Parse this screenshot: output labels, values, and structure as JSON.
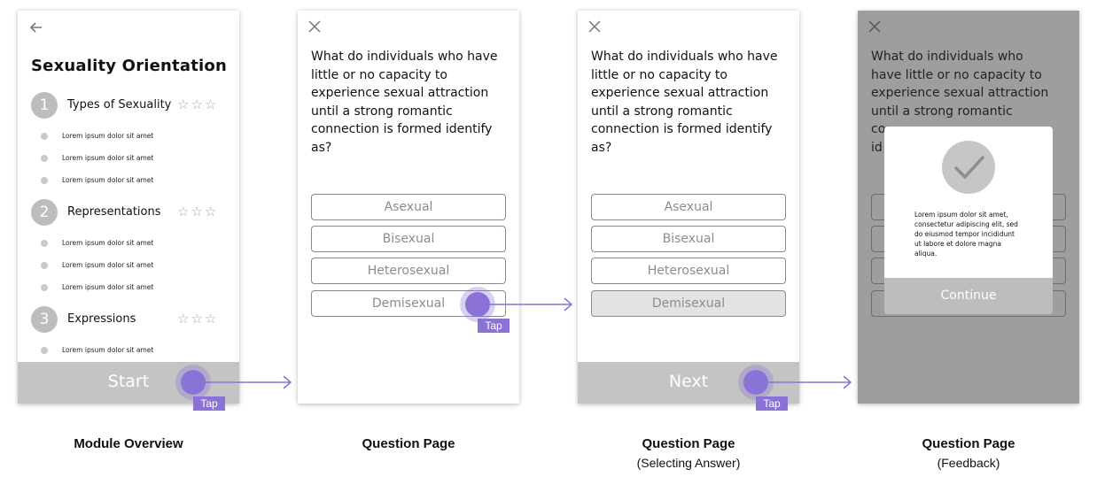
{
  "screens": {
    "module_overview": {
      "title": "Sexuality Orientation",
      "sections": [
        {
          "number": "1",
          "label": "Types of Sexuality",
          "stars": "☆☆☆",
          "items": [
            "Lorem ipsum dolor sit amet",
            "Lorem ipsum dolor sit amet",
            "Lorem ipsum dolor sit amet"
          ]
        },
        {
          "number": "2",
          "label": "Representations",
          "stars": "☆☆☆",
          "items": [
            "Lorem ipsum dolor sit amet",
            "Lorem ipsum dolor sit amet",
            "Lorem ipsum dolor sit amet"
          ]
        },
        {
          "number": "3",
          "label": "Expressions",
          "stars": "☆☆☆",
          "items": [
            "Lorem ipsum dolor sit amet"
          ]
        }
      ],
      "cta_label": "Start",
      "caption": {
        "title": "Module Overview"
      }
    },
    "question_page": {
      "question": "What do individuals who have little or no capacity to experience sexual attraction until a strong romantic connection is formed identify as?",
      "options": [
        "Asexual",
        "Bisexual",
        "Heterosexual",
        "Demisexual"
      ],
      "caption": {
        "title": "Question Page"
      }
    },
    "question_selecting": {
      "question": "What do individuals who have little or no capacity to experience sexual attraction until a strong romantic connection is formed identify as?",
      "options": [
        "Asexual",
        "Bisexual",
        "Heterosexual",
        "Demisexual"
      ],
      "selected_option": "Demisexual",
      "cta_label": "Next",
      "caption": {
        "title": "Question Page",
        "subtitle": "(Selecting Answer)"
      }
    },
    "question_feedback": {
      "question_visible_lines": [
        "What do individuals who",
        "have little or no capacity to",
        "experience sexual attraction",
        "until a strong romantic",
        "co",
        "id"
      ],
      "modal_text": "Lorem ipsum dolor sit amet, consectetur adipiscing elit, sed do eiusmod tempor incididunt ut labore et dolore magna aliqua.",
      "modal_button": "Continue",
      "caption": {
        "title": "Question Page",
        "subtitle": "(Feedback)"
      }
    }
  },
  "gesture_label": "Tap",
  "colors": {
    "accent": "#8b72d6",
    "cta_gray": "#c4c4c4",
    "overlay_gray": "#9e9e9e"
  },
  "icons": [
    "back-arrow-icon",
    "close-icon",
    "star-icon",
    "checkmark-icon"
  ]
}
